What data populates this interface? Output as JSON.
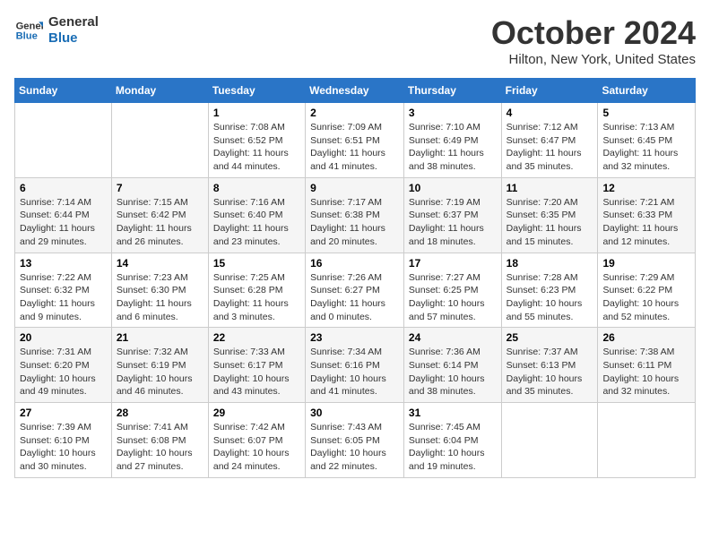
{
  "logo": {
    "line1": "General",
    "line2": "Blue"
  },
  "title": "October 2024",
  "location": "Hilton, New York, United States",
  "days_of_week": [
    "Sunday",
    "Monday",
    "Tuesday",
    "Wednesday",
    "Thursday",
    "Friday",
    "Saturday"
  ],
  "weeks": [
    [
      {
        "num": "",
        "detail": ""
      },
      {
        "num": "",
        "detail": ""
      },
      {
        "num": "1",
        "detail": "Sunrise: 7:08 AM\nSunset: 6:52 PM\nDaylight: 11 hours and 44 minutes."
      },
      {
        "num": "2",
        "detail": "Sunrise: 7:09 AM\nSunset: 6:51 PM\nDaylight: 11 hours and 41 minutes."
      },
      {
        "num": "3",
        "detail": "Sunrise: 7:10 AM\nSunset: 6:49 PM\nDaylight: 11 hours and 38 minutes."
      },
      {
        "num": "4",
        "detail": "Sunrise: 7:12 AM\nSunset: 6:47 PM\nDaylight: 11 hours and 35 minutes."
      },
      {
        "num": "5",
        "detail": "Sunrise: 7:13 AM\nSunset: 6:45 PM\nDaylight: 11 hours and 32 minutes."
      }
    ],
    [
      {
        "num": "6",
        "detail": "Sunrise: 7:14 AM\nSunset: 6:44 PM\nDaylight: 11 hours and 29 minutes."
      },
      {
        "num": "7",
        "detail": "Sunrise: 7:15 AM\nSunset: 6:42 PM\nDaylight: 11 hours and 26 minutes."
      },
      {
        "num": "8",
        "detail": "Sunrise: 7:16 AM\nSunset: 6:40 PM\nDaylight: 11 hours and 23 minutes."
      },
      {
        "num": "9",
        "detail": "Sunrise: 7:17 AM\nSunset: 6:38 PM\nDaylight: 11 hours and 20 minutes."
      },
      {
        "num": "10",
        "detail": "Sunrise: 7:19 AM\nSunset: 6:37 PM\nDaylight: 11 hours and 18 minutes."
      },
      {
        "num": "11",
        "detail": "Sunrise: 7:20 AM\nSunset: 6:35 PM\nDaylight: 11 hours and 15 minutes."
      },
      {
        "num": "12",
        "detail": "Sunrise: 7:21 AM\nSunset: 6:33 PM\nDaylight: 11 hours and 12 minutes."
      }
    ],
    [
      {
        "num": "13",
        "detail": "Sunrise: 7:22 AM\nSunset: 6:32 PM\nDaylight: 11 hours and 9 minutes."
      },
      {
        "num": "14",
        "detail": "Sunrise: 7:23 AM\nSunset: 6:30 PM\nDaylight: 11 hours and 6 minutes."
      },
      {
        "num": "15",
        "detail": "Sunrise: 7:25 AM\nSunset: 6:28 PM\nDaylight: 11 hours and 3 minutes."
      },
      {
        "num": "16",
        "detail": "Sunrise: 7:26 AM\nSunset: 6:27 PM\nDaylight: 11 hours and 0 minutes."
      },
      {
        "num": "17",
        "detail": "Sunrise: 7:27 AM\nSunset: 6:25 PM\nDaylight: 10 hours and 57 minutes."
      },
      {
        "num": "18",
        "detail": "Sunrise: 7:28 AM\nSunset: 6:23 PM\nDaylight: 10 hours and 55 minutes."
      },
      {
        "num": "19",
        "detail": "Sunrise: 7:29 AM\nSunset: 6:22 PM\nDaylight: 10 hours and 52 minutes."
      }
    ],
    [
      {
        "num": "20",
        "detail": "Sunrise: 7:31 AM\nSunset: 6:20 PM\nDaylight: 10 hours and 49 minutes."
      },
      {
        "num": "21",
        "detail": "Sunrise: 7:32 AM\nSunset: 6:19 PM\nDaylight: 10 hours and 46 minutes."
      },
      {
        "num": "22",
        "detail": "Sunrise: 7:33 AM\nSunset: 6:17 PM\nDaylight: 10 hours and 43 minutes."
      },
      {
        "num": "23",
        "detail": "Sunrise: 7:34 AM\nSunset: 6:16 PM\nDaylight: 10 hours and 41 minutes."
      },
      {
        "num": "24",
        "detail": "Sunrise: 7:36 AM\nSunset: 6:14 PM\nDaylight: 10 hours and 38 minutes."
      },
      {
        "num": "25",
        "detail": "Sunrise: 7:37 AM\nSunset: 6:13 PM\nDaylight: 10 hours and 35 minutes."
      },
      {
        "num": "26",
        "detail": "Sunrise: 7:38 AM\nSunset: 6:11 PM\nDaylight: 10 hours and 32 minutes."
      }
    ],
    [
      {
        "num": "27",
        "detail": "Sunrise: 7:39 AM\nSunset: 6:10 PM\nDaylight: 10 hours and 30 minutes."
      },
      {
        "num": "28",
        "detail": "Sunrise: 7:41 AM\nSunset: 6:08 PM\nDaylight: 10 hours and 27 minutes."
      },
      {
        "num": "29",
        "detail": "Sunrise: 7:42 AM\nSunset: 6:07 PM\nDaylight: 10 hours and 24 minutes."
      },
      {
        "num": "30",
        "detail": "Sunrise: 7:43 AM\nSunset: 6:05 PM\nDaylight: 10 hours and 22 minutes."
      },
      {
        "num": "31",
        "detail": "Sunrise: 7:45 AM\nSunset: 6:04 PM\nDaylight: 10 hours and 19 minutes."
      },
      {
        "num": "",
        "detail": ""
      },
      {
        "num": "",
        "detail": ""
      }
    ]
  ]
}
